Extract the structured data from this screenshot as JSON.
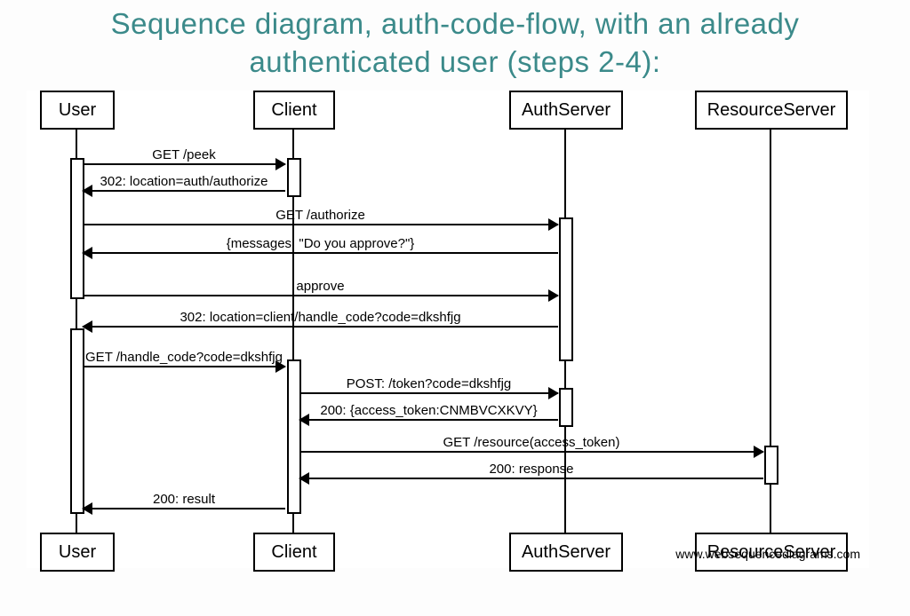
{
  "title_line1": "Sequence diagram, auth-code-flow, with an already",
  "title_line2": "authenticated user (steps 2-4):",
  "participants": {
    "user": "User",
    "client": "Client",
    "authserver": "AuthServer",
    "resourceserver": "ResourceServer"
  },
  "messages": {
    "m1": "GET /peek",
    "m2": "302: location=auth/authorize",
    "m3": "GET /authorize",
    "m4": "{messages: \"Do you approve?\"}",
    "m5": "approve",
    "m6": "302: location=client/handle_code?code=dkshfjg",
    "m7": "GET /handle_code?code=dkshfjg",
    "m8": "POST: /token?code=dkshfjg",
    "m9": "200: {access_token:CNMBVCXKVY}",
    "m10": "GET /resource(access_token)",
    "m11": "200: response",
    "m12": "200: result"
  },
  "footer": "www.websequencediagrams.com"
}
